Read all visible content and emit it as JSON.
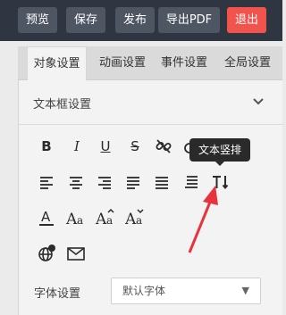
{
  "toolbar": {
    "preview": "预览",
    "save": "保存",
    "publish": "发布",
    "export_pdf": "导出PDF",
    "exit": "退出"
  },
  "tabs": [
    {
      "label": "对象设置",
      "active": true
    },
    {
      "label": "动画设置",
      "active": false
    },
    {
      "label": "事件设置",
      "active": false
    },
    {
      "label": "全局设置",
      "active": false
    }
  ],
  "panel": {
    "title": "文本框设置",
    "tooltip": "文本竖排",
    "font_label": "字体设置",
    "font_value": "默认字体",
    "icons": {
      "row1": [
        "bold-icon",
        "italic-icon",
        "underline-icon",
        "strikethrough-icon",
        "unlink-icon"
      ],
      "row2": [
        "align-left-icon",
        "align-center-icon",
        "align-right-icon",
        "align-justify-icon",
        "align-distribute-icon",
        "line-spacing-icon",
        "vertical-text-icon"
      ],
      "row3": [
        "font-color-icon",
        "font-size-icon",
        "increase-font-icon",
        "decrease-font-icon"
      ],
      "row4": [
        "globe-link-icon",
        "email-icon"
      ]
    }
  },
  "colors": {
    "topbar": "#2f3642",
    "button": "#4f5663",
    "danger": "#f2544d",
    "arrow": "#e8323c"
  }
}
